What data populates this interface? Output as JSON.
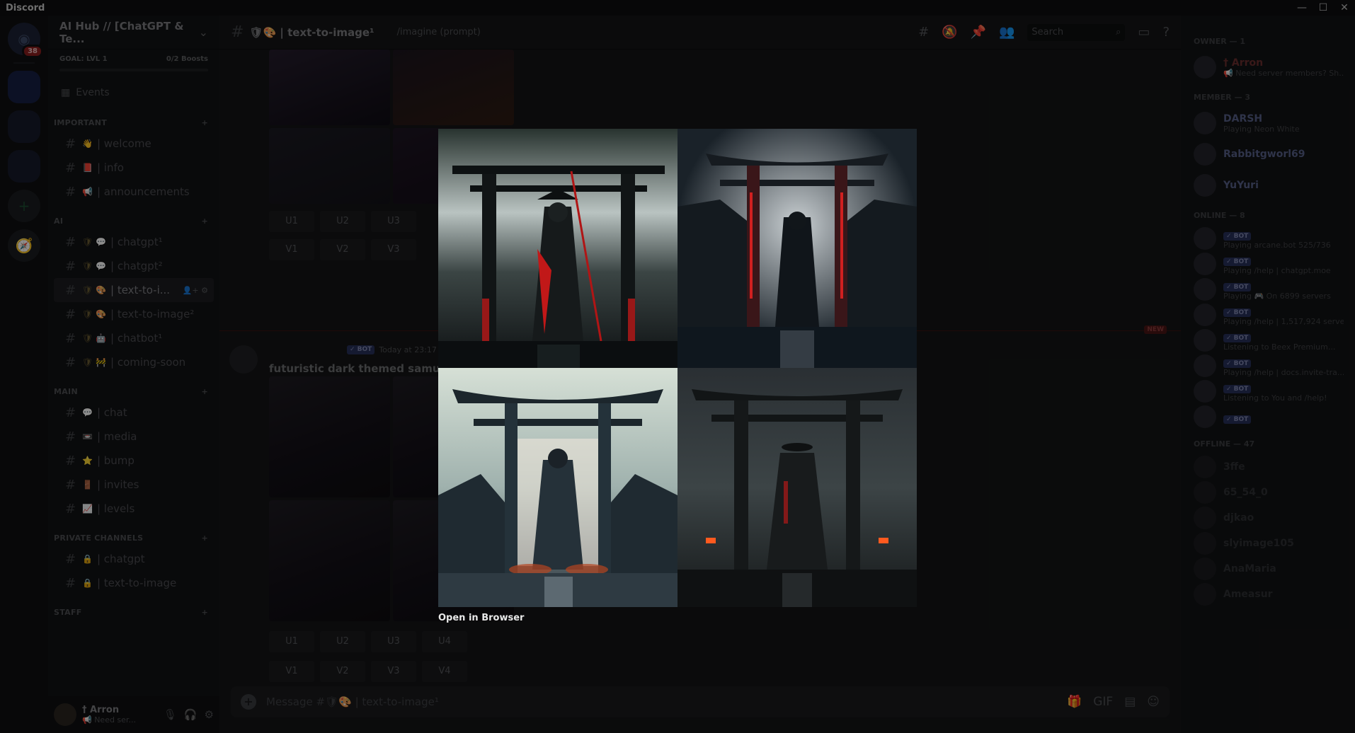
{
  "window": {
    "app_title": "Discord"
  },
  "guilds": {
    "badge_count": "38"
  },
  "server": {
    "name": "AI Hub // [ChatGPT & Te...",
    "goal_label": "GOAL: LVL 1",
    "boosts": "0/2 Boosts",
    "events_label": "Events"
  },
  "categories": [
    {
      "label": "IMPORTANT",
      "channels": [
        {
          "emoji": "👋",
          "name": "| welcome"
        },
        {
          "emoji": "📕",
          "name": "| info"
        },
        {
          "emoji": "📢",
          "name": "| announcements"
        }
      ]
    },
    {
      "label": "AI",
      "channels": [
        {
          "emoji": "🛡 💬",
          "name": "| chatgpt¹"
        },
        {
          "emoji": "🛡 💬",
          "name": "| chatgpt²"
        },
        {
          "emoji": "🛡 🎨",
          "name": "| text-to-i...",
          "active": true
        },
        {
          "emoji": "🛡 🎨",
          "name": "| text-to-image²"
        },
        {
          "emoji": "🛡 🤖",
          "name": "| chatbot¹"
        },
        {
          "emoji": "🛡 🚧",
          "name": "| coming-soon"
        }
      ]
    },
    {
      "label": "MAIN",
      "channels": [
        {
          "emoji": "💬",
          "name": "| chat"
        },
        {
          "emoji": "📼",
          "name": "| media"
        },
        {
          "emoji": "⭐",
          "name": "| bump"
        },
        {
          "emoji": "🚪",
          "name": "| invites"
        },
        {
          "emoji": "📈",
          "name": "| levels"
        }
      ]
    },
    {
      "label": "PRIVATE CHANNELS",
      "channels": [
        {
          "emoji": "🔒",
          "name": "| chatgpt"
        },
        {
          "emoji": "🔒",
          "name": "| text-to-image"
        }
      ]
    },
    {
      "label": "STAFF",
      "channels": []
    }
  ],
  "user": {
    "name": "† Arron",
    "status": "📢 Need ser..."
  },
  "channel_header": {
    "name": "🛡🎨 | text-to-image¹",
    "topic": "/imagine (prompt)",
    "search_placeholder": "Search"
  },
  "chat": {
    "upscale_buttons": [
      "U1",
      "U2",
      "U3",
      "U4"
    ],
    "variation_buttons": [
      "V1",
      "V2",
      "V3",
      "V4"
    ],
    "new_tag": "NEW",
    "bot_tag": "✓ BOT",
    "timestamp": "Today at 23:17",
    "message_text": "futuristic dark themed samurai st",
    "composer_placeholder": "Message #🛡🎨 | text-to-image¹"
  },
  "members": {
    "owner_header": "OWNER — 1",
    "owner": {
      "name": "† Arron",
      "activity": "📢 Need server members? Sh..."
    },
    "member_header": "MEMBER — 3",
    "member_list": [
      {
        "name": "DARSH",
        "activity": "Playing Neon White"
      },
      {
        "name": "Rabbitgworl69",
        "activity": ""
      },
      {
        "name": "YuYuri",
        "activity": ""
      }
    ],
    "online_header": "ONLINE — 8",
    "online_list": [
      {
        "activity": "Playing arcane.bot 525/736"
      },
      {
        "activity": "Playing /help | chatgpt.moe"
      },
      {
        "activity": "Playing 🎮 On 6899 servers"
      },
      {
        "activity": "Playing /help | 1,517,924 serve..."
      },
      {
        "activity": "Listening to Beex Premium..."
      },
      {
        "activity": "Playing /help | docs.invite-tra..."
      },
      {
        "activity": "Listening to You and /help!"
      },
      {
        "activity": ""
      }
    ],
    "offline_header": "OFFLINE — 47",
    "offline_list": [
      "3ffe",
      "65_54_0",
      "djkao",
      "slyimage105",
      "AnaMaria",
      "Ameasur"
    ]
  },
  "viewer": {
    "open_in_browser": "Open in Browser"
  },
  "colors": {
    "accent": "#5865f2",
    "red_glow": "#d21a1a",
    "sky": "#c9d6d6"
  }
}
